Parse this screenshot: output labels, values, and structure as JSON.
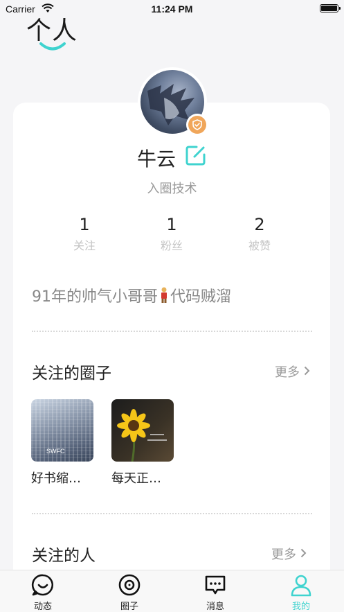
{
  "status_bar": {
    "carrier": "Carrier",
    "time": "11:24 PM"
  },
  "header": {
    "title": "个人"
  },
  "profile": {
    "name": "牛云",
    "join_info": "入圈技术",
    "stats": [
      {
        "value": "1",
        "label": "关注"
      },
      {
        "value": "1",
        "label": "粉丝"
      },
      {
        "value": "2",
        "label": "被赞"
      }
    ],
    "bio_before": "91年的帅气小哥哥",
    "bio_after": "代码贼溜"
  },
  "circles_section": {
    "title": "关注的圈子",
    "more": "更多",
    "items": [
      {
        "name": "好书缩…",
        "thumb_text": "SWFC"
      },
      {
        "name": "每天正…"
      }
    ]
  },
  "people_section": {
    "title": "关注的人",
    "more": "更多"
  },
  "tabs": [
    {
      "label": "动态",
      "icon": "smile-chat-icon"
    },
    {
      "label": "圈子",
      "icon": "target-circle-icon"
    },
    {
      "label": "消息",
      "icon": "message-icon"
    },
    {
      "label": "我的",
      "icon": "person-icon",
      "active": true
    }
  ],
  "colors": {
    "accent": "#3fd3cf",
    "badge": "#f0a65a",
    "muted": "#999999"
  }
}
